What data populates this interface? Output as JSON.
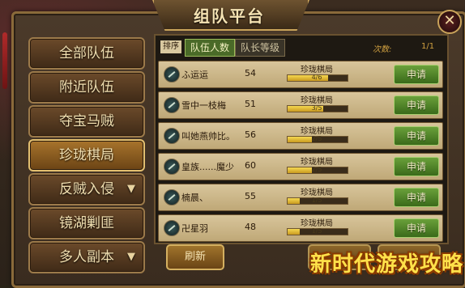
{
  "window": {
    "title": "组队平台",
    "close_glyph": "✕"
  },
  "sidebar": {
    "items": [
      {
        "label": "全部队伍",
        "active": false,
        "has_dropdown": false
      },
      {
        "label": "附近队伍",
        "active": false,
        "has_dropdown": false
      },
      {
        "label": "夺宝马贼",
        "active": false,
        "has_dropdown": false
      },
      {
        "label": "珍珑棋局",
        "active": true,
        "has_dropdown": false
      },
      {
        "label": "反贼入侵",
        "active": false,
        "has_dropdown": true
      },
      {
        "label": "镜湖剿匪",
        "active": false,
        "has_dropdown": false
      },
      {
        "label": "多人副本",
        "active": false,
        "has_dropdown": true
      }
    ],
    "dropdown_glyph": "▼"
  },
  "sort_bar": {
    "label": "排序",
    "options": [
      {
        "label": "队伍人数",
        "active": true
      },
      {
        "label": "队长等级",
        "active": false
      }
    ],
    "count_label": "次数:",
    "count_value": "1/1"
  },
  "teams": [
    {
      "name": "ふ运运",
      "level": "54",
      "activity": "珍珑棋局",
      "members": "4/6",
      "fill": 0.67,
      "apply_label": "申请"
    },
    {
      "name": "雪中一枝梅",
      "level": "51",
      "activity": "珍珑棋局",
      "members": "3/5",
      "fill": 0.6,
      "apply_label": "申请"
    },
    {
      "name": "叫她燕帅比。",
      "level": "56",
      "activity": "珍珑棋局",
      "members": "2/5",
      "fill": 0.4,
      "apply_label": "申请"
    },
    {
      "name": "皇族......魔少",
      "level": "60",
      "activity": "珍珑棋局",
      "members": "2/5",
      "fill": 0.4,
      "apply_label": "申请"
    },
    {
      "name": "楠晨、",
      "level": "55",
      "activity": "珍珑棋局",
      "members": "1/5",
      "fill": 0.2,
      "apply_label": "申请"
    },
    {
      "name": "卍星羽",
      "level": "48",
      "activity": "珍珑棋局",
      "members": "1/5",
      "fill": 0.2,
      "apply_label": "申请"
    }
  ],
  "footer": {
    "refresh_label": "刷新"
  },
  "watermark": "新时代游戏攻略",
  "colors": {
    "accent_gold": "#c9a35a",
    "apply_green": "#6aa03a",
    "active_tab": "#4a6a28"
  }
}
